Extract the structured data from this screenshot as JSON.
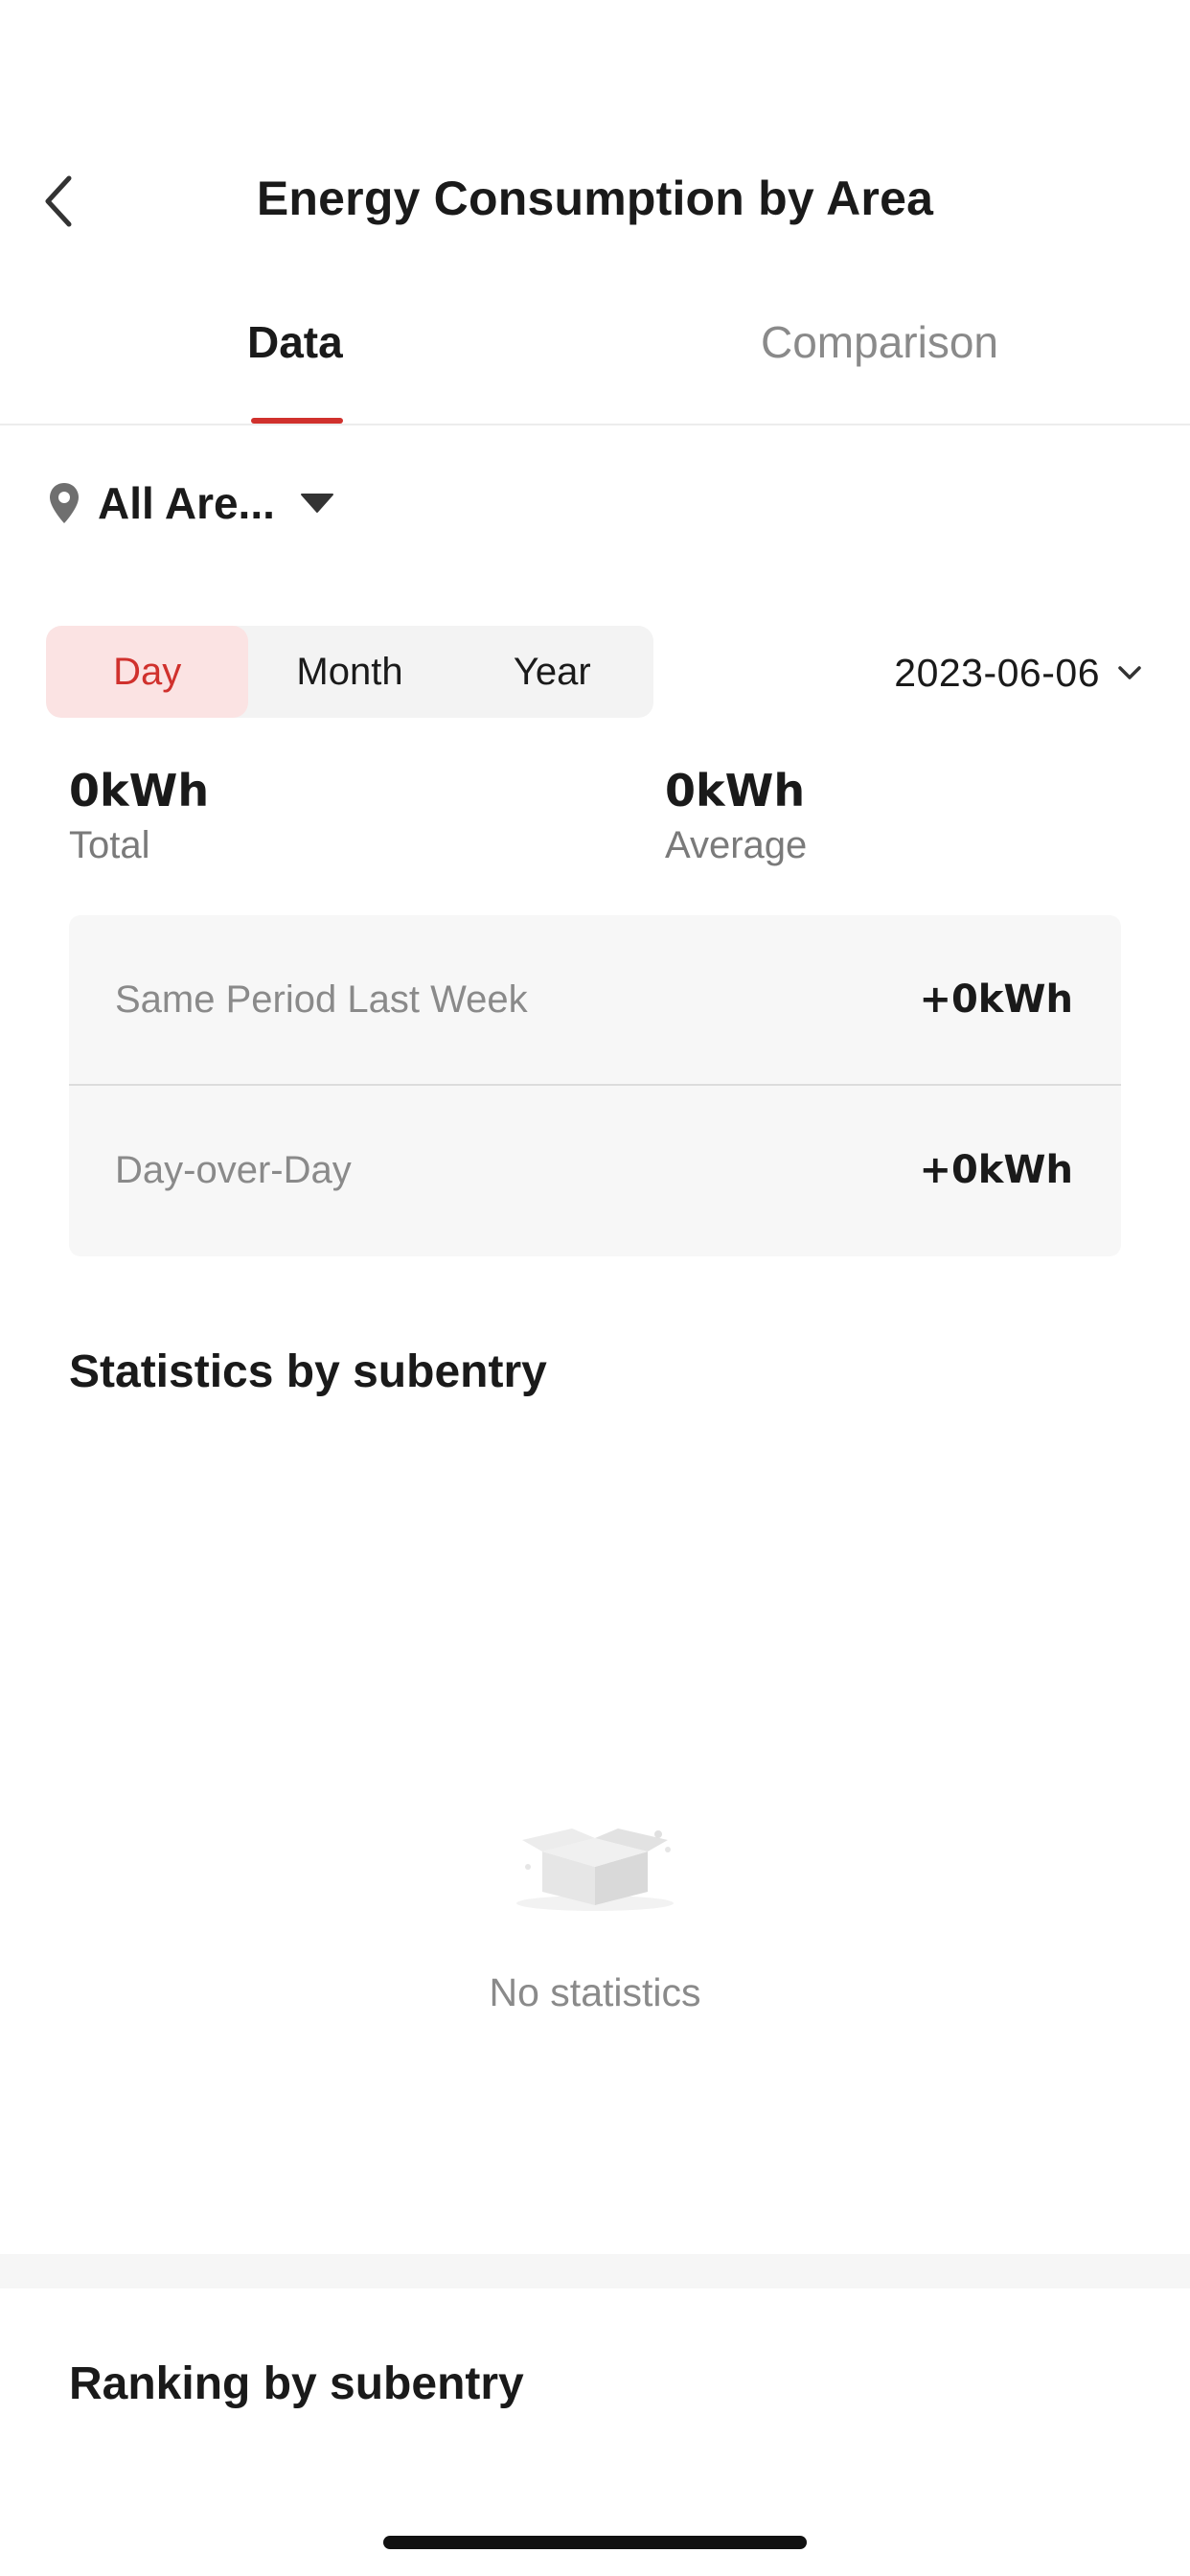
{
  "header": {
    "title": "Energy Consumption by Area",
    "back_icon": "chevron-left-icon"
  },
  "tabs": [
    {
      "label": "Data",
      "active": true
    },
    {
      "label": "Comparison",
      "active": false
    }
  ],
  "area_selector": {
    "label": "All Are...",
    "icon": "location-pin-icon",
    "caret_icon": "caret-down-icon"
  },
  "period": {
    "options": [
      "Day",
      "Month",
      "Year"
    ],
    "selected": "Day"
  },
  "date_picker": {
    "value": "2023-06-06",
    "icon": "chevron-down-icon"
  },
  "summary": {
    "total_value": "0kWh",
    "total_label": "Total",
    "average_value": "0kWh",
    "average_label": "Average"
  },
  "comparisons": [
    {
      "label": "Same Period Last Week",
      "value": "+0kWh"
    },
    {
      "label": "Day-over-Day",
      "value": "+0kWh"
    }
  ],
  "statistics": {
    "title": "Statistics by subentry",
    "empty_text": "No statistics",
    "empty_icon": "empty-box-icon"
  },
  "ranking": {
    "title": "Ranking by subentry"
  },
  "colors": {
    "accent": "#d0312d",
    "accent_bg": "#fbe3e3",
    "muted_text": "#8a8a8a",
    "card_bg": "#f7f7f7"
  }
}
